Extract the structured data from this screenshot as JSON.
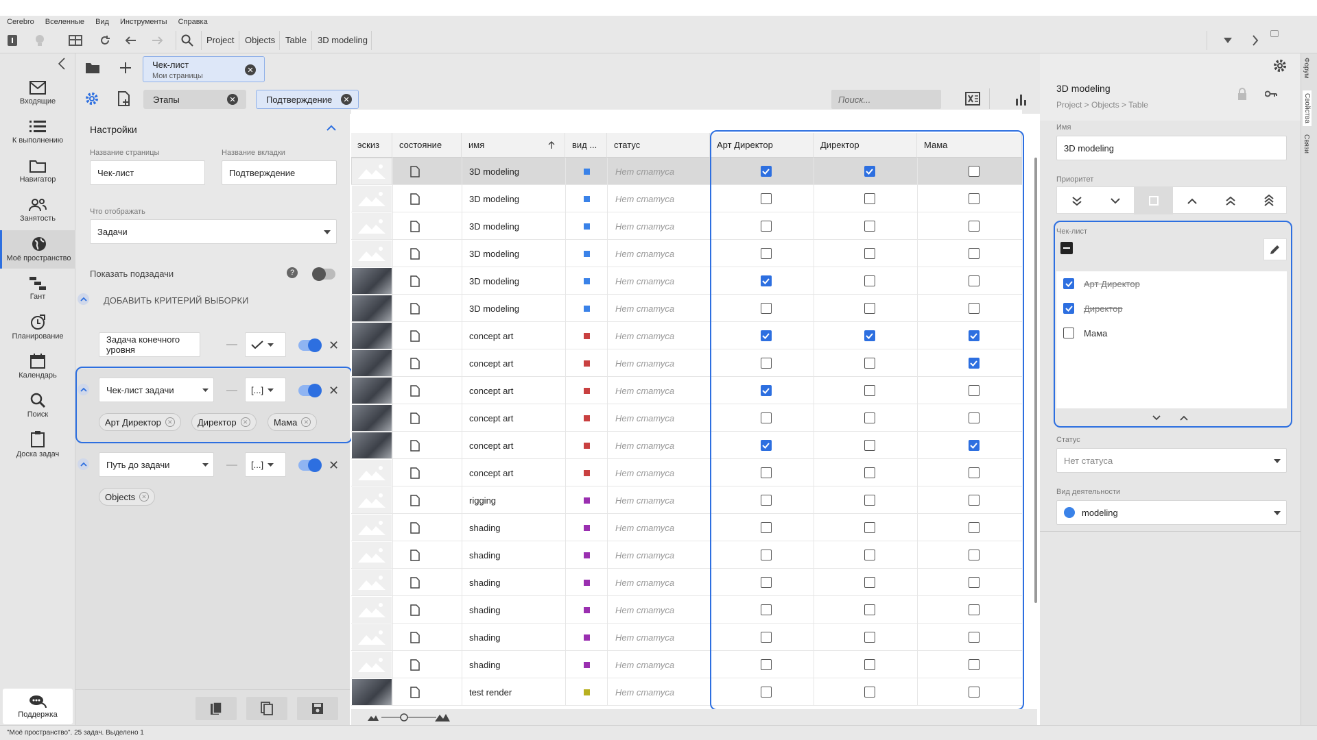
{
  "menu": [
    "Cerebro",
    "Вселенные",
    "Вид",
    "Инструменты",
    "Справка"
  ],
  "breadcrumbs": [
    "Project",
    "Objects",
    "Table",
    "3D modeling"
  ],
  "nav": [
    {
      "label": "Входящие",
      "icon": "mail-icon"
    },
    {
      "label": "К выполнению",
      "icon": "list-icon"
    },
    {
      "label": "Навигатор",
      "icon": "folder-icon"
    },
    {
      "label": "Занятость",
      "icon": "people-icon"
    },
    {
      "label": "Моё пространство",
      "icon": "globe-icon",
      "active": true
    },
    {
      "label": "Гант",
      "icon": "gantt-icon"
    },
    {
      "label": "Планирование",
      "icon": "planning-icon"
    },
    {
      "label": "Календарь",
      "icon": "calendar-icon"
    },
    {
      "label": "Поиск",
      "icon": "search-icon"
    },
    {
      "label": "Доска задач",
      "icon": "clipboard-icon"
    }
  ],
  "support": "Поддержка",
  "page_tab": {
    "title": "Чек-лист",
    "subtitle": "Мои страницы"
  },
  "subtabs": [
    "Этапы",
    "Подтверждение"
  ],
  "search_placeholder": "Поиск...",
  "settings": {
    "header": "Настройки",
    "page_name_label": "Название страницы",
    "page_name_value": "Чек-лист",
    "tab_name_label": "Название вкладки",
    "tab_name_value": "Подтверждение",
    "display_label": "Что отображать",
    "display_value": "Задачи",
    "show_subtasks": "Показать подзадачи",
    "add_criterion": "ДОБАВИТЬ КРИТЕРИЙ ВЫБОРКИ",
    "criterion1": "Задача конечного уровня",
    "criterion2": "Чек-лист задачи",
    "criterion2_tags": [
      "Арт Директор",
      "Директор",
      "Мама"
    ],
    "criterion3": "Путь до задачи",
    "criterion3_tags": [
      "Objects"
    ],
    "op_bracket": "[...]"
  },
  "columns": [
    "эскиз",
    "состояние",
    "имя",
    "вид ...",
    "статус",
    "Арт Директор",
    "Директор",
    "Мама"
  ],
  "rows": [
    {
      "name": "3D modeling",
      "color": "#3a82e8",
      "status": "Нет статуса",
      "art": true,
      "dir": true,
      "mama": false,
      "selected": true
    },
    {
      "name": "3D modeling",
      "color": "#3a82e8",
      "status": "Нет статуса",
      "art": false,
      "dir": false,
      "mama": false
    },
    {
      "name": "3D modeling",
      "color": "#3a82e8",
      "status": "Нет статуса",
      "art": false,
      "dir": false,
      "mama": false
    },
    {
      "name": "3D modeling",
      "color": "#3a82e8",
      "status": "Нет статуса",
      "art": false,
      "dir": false,
      "mama": false
    },
    {
      "name": "3D modeling",
      "color": "#3a82e8",
      "status": "Нет статуса",
      "art": true,
      "dir": false,
      "mama": false,
      "thumb": true
    },
    {
      "name": "3D modeling",
      "color": "#3a82e8",
      "status": "Нет статуса",
      "art": false,
      "dir": false,
      "mama": false,
      "thumb": true
    },
    {
      "name": "concept art",
      "color": "#c94040",
      "status": "Нет статуса",
      "art": true,
      "dir": true,
      "mama": true,
      "thumb": true
    },
    {
      "name": "concept art",
      "color": "#c94040",
      "status": "Нет статуса",
      "art": false,
      "dir": false,
      "mama": true,
      "thumb": true
    },
    {
      "name": "concept art",
      "color": "#c94040",
      "status": "Нет статуса",
      "art": true,
      "dir": false,
      "mama": false,
      "thumb": true
    },
    {
      "name": "concept art",
      "color": "#c94040",
      "status": "Нет статуса",
      "art": false,
      "dir": false,
      "mama": false,
      "thumb": true
    },
    {
      "name": "concept art",
      "color": "#c94040",
      "status": "Нет статуса",
      "art": true,
      "dir": false,
      "mama": true,
      "thumb": true
    },
    {
      "name": "concept art",
      "color": "#c94040",
      "status": "Нет статуса",
      "art": false,
      "dir": false,
      "mama": false
    },
    {
      "name": "rigging",
      "color": "#9a2fb0",
      "status": "Нет статуса",
      "art": false,
      "dir": false,
      "mama": false
    },
    {
      "name": "shading",
      "color": "#9a2fb0",
      "status": "Нет статуса",
      "art": false,
      "dir": false,
      "mama": false
    },
    {
      "name": "shading",
      "color": "#9a2fb0",
      "status": "Нет статуса",
      "art": false,
      "dir": false,
      "mama": false
    },
    {
      "name": "shading",
      "color": "#9a2fb0",
      "status": "Нет статуса",
      "art": false,
      "dir": false,
      "mama": false
    },
    {
      "name": "shading",
      "color": "#9a2fb0",
      "status": "Нет статуса",
      "art": false,
      "dir": false,
      "mama": false
    },
    {
      "name": "shading",
      "color": "#9a2fb0",
      "status": "Нет статуса",
      "art": false,
      "dir": false,
      "mama": false
    },
    {
      "name": "shading",
      "color": "#9a2fb0",
      "status": "Нет статуса",
      "art": false,
      "dir": false,
      "mama": false
    },
    {
      "name": "test render",
      "color": "#b8b020",
      "status": "Нет статуса",
      "art": false,
      "dir": false,
      "mama": false,
      "thumb": true
    }
  ],
  "details": {
    "title": "3D modeling",
    "path": "Project > Objects > Table",
    "name_label": "Имя",
    "name_value": "3D modeling",
    "priority_label": "Приоритет",
    "checklist_label": "Чек-лист",
    "checklist": [
      {
        "label": "Арт Директор",
        "checked": true
      },
      {
        "label": "Директор",
        "checked": true
      },
      {
        "label": "Мама",
        "checked": false
      }
    ],
    "status_label": "Статус",
    "status_value": "Нет статуса",
    "activity_label": "Вид деятельности",
    "activity_value": "modeling",
    "activity_color": "#3a82e8"
  },
  "side_tabs": [
    "Форум",
    "Свойства",
    "Связи"
  ],
  "statusbar": "\"Моё пространство\". 25 задач. Выделено 1",
  "accent": "#2d6fe0"
}
